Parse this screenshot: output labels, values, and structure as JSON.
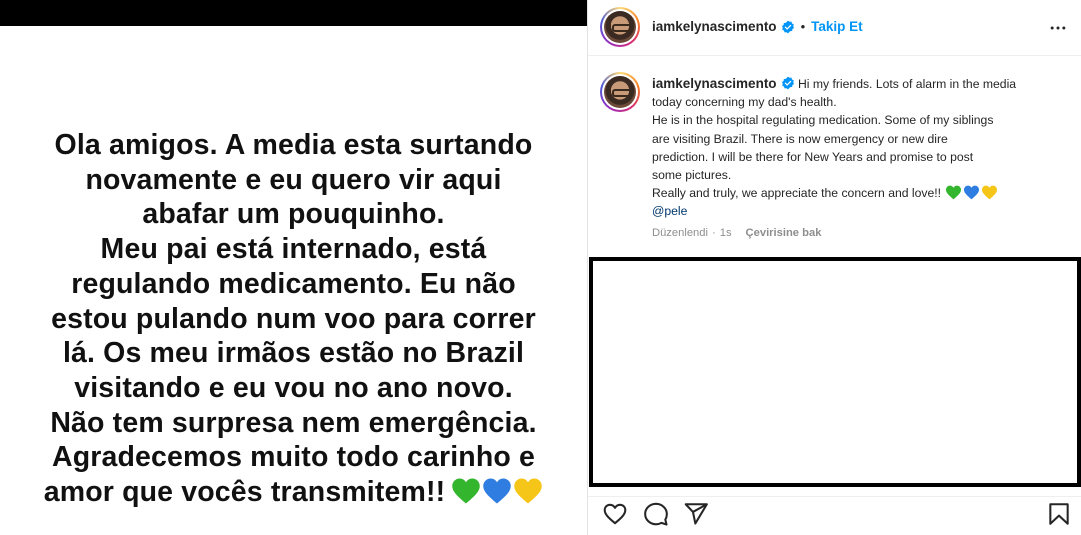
{
  "story": {
    "lines": [
      "Ola amigos. A media esta surtando",
      "novamente e eu quero vir aqui",
      "abafar um pouquinho.",
      "Meu pai está internado, está",
      "regulando medicamento. Eu não",
      "estou pulando num voo para correr",
      "lá. Os meu irmãos estão no Brazil",
      "visitando e eu vou no ano novo.",
      "Não tem surpresa nem emergência.",
      "Agradecemos muito todo carinho e",
      "amor que vocês transmitem!!"
    ],
    "heart_colors": [
      "#33b52e",
      "#2f7de1",
      "#f5c518"
    ]
  },
  "post": {
    "username": "iamkelynascimento",
    "separator": "•",
    "follow_label": "Takip Et",
    "caption": {
      "username": "iamkelynascimento",
      "lines": [
        "Hi my friends. Lots of alarm in the media",
        "today concerning my dad's health.",
        "He is in the hospital regulating medication. Some of my siblings",
        "are visiting Brazil. There is now emergency or new dire",
        "prediction. I will be there for New Years and promise to post",
        "some pictures.",
        "Really and truly, we appreciate the concern and love!!"
      ],
      "mention": "@pele"
    },
    "meta": {
      "edited": "Düzenlendi",
      "dot": "·",
      "time": "1s",
      "translate": "Çevirisine bak"
    },
    "icons": {
      "verified": "verified-badge-icon",
      "more": "more-options-icon",
      "like": "heart-outline-icon",
      "comment": "comment-icon",
      "share": "paper-plane-icon",
      "save": "bookmark-icon"
    },
    "colors": {
      "link": "#0095f6",
      "verified": "#0095f6",
      "mention": "#00376b"
    }
  }
}
